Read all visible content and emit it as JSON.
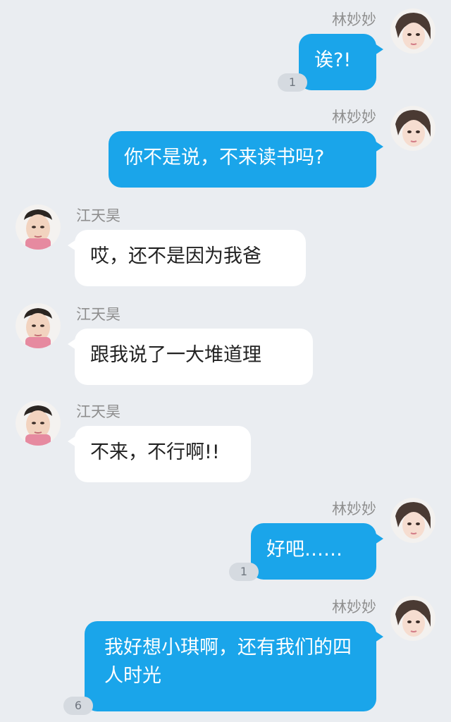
{
  "messages": [
    {
      "side": "right",
      "sender": "林妙妙",
      "text": "诶?!",
      "read_count": "1"
    },
    {
      "side": "right",
      "sender": "林妙妙",
      "text": "你不是说，不来读书吗?"
    },
    {
      "side": "left",
      "sender": "江天昊",
      "text": "哎，还不是因为我爸"
    },
    {
      "side": "left",
      "sender": "江天昊",
      "text": "跟我说了一大堆道理"
    },
    {
      "side": "left",
      "sender": "江天昊",
      "text": "不来，不行啊!!"
    },
    {
      "side": "right",
      "sender": "林妙妙",
      "text": "好吧……",
      "read_count": "1"
    },
    {
      "side": "right",
      "sender": "林妙妙",
      "text": "我好想小琪啊，还有我们的四人时光",
      "read_count": "6"
    }
  ],
  "colors": {
    "background": "#eaedf1",
    "sent_bubble": "#1aa5ea",
    "received_bubble": "#ffffff",
    "badge": "#d5dae0"
  },
  "icons": {
    "female_avatar": "girl-avatar-icon",
    "male_avatar": "boy-avatar-icon"
  }
}
